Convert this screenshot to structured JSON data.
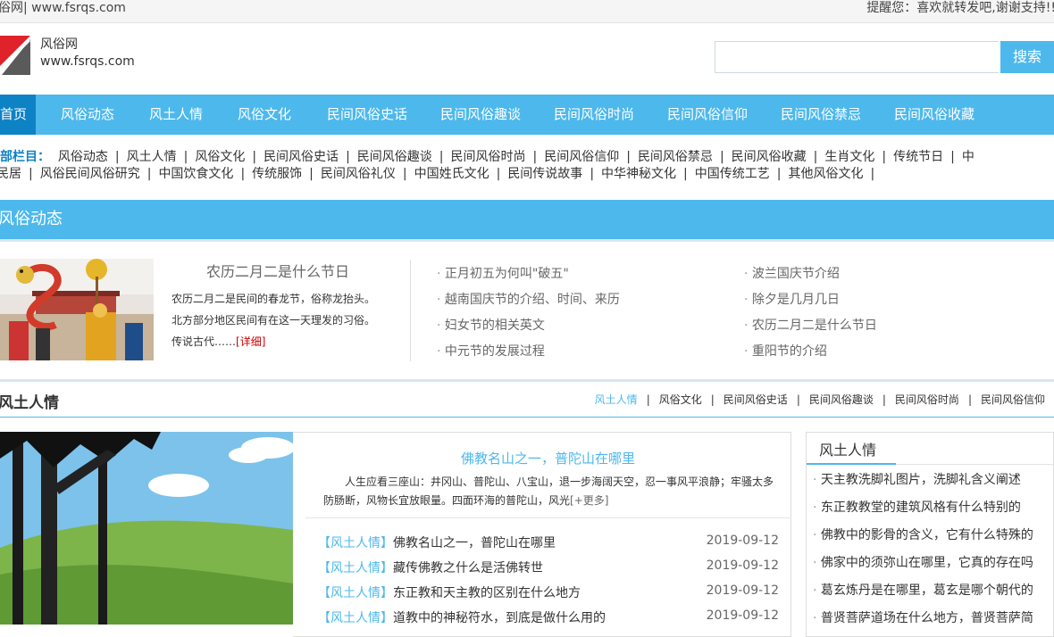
{
  "topbar": {
    "left_text": "风俗网| www.fsrqs.com",
    "right_text": "提醒您：喜欢就转发吧,谢谢支持!!"
  },
  "header": {
    "site_name": "风俗网",
    "site_url": "www.fsrqs.com",
    "search_placeholder": "",
    "search_button": "搜索"
  },
  "nav": {
    "items": [
      "首页",
      "风俗动态",
      "风土人情",
      "风俗文化",
      "民间风俗史话",
      "民间风俗趣谈",
      "民间风俗时尚",
      "民间风俗信仰",
      "民间风俗禁忌",
      "民间风俗收藏"
    ]
  },
  "all_columns": {
    "label": "全部栏目：",
    "row1": [
      "风俗动态",
      "风土人情",
      "风俗文化",
      "民间风俗史话",
      "民间风俗趣谈",
      "民间风俗时尚",
      "民间风俗信仰",
      "民间风俗禁忌",
      "民间风俗收藏",
      "生肖文化",
      "传统节日",
      "中"
    ],
    "row2": [
      "民居",
      "风俗民间风俗研究",
      "中国饮食文化",
      "传统服饰",
      "民间风俗礼仪",
      "中国姓氏文化",
      "民间传说故事",
      "中华神秘文化",
      "中国传统工艺",
      "其他风俗文化"
    ]
  },
  "section1": {
    "title": "风俗动态",
    "feature_title": "农历二月二是什么节日",
    "feature_text": "农历二月二是民间的春龙节，俗称龙抬头。北方部分地区民间有在这一天理发的习俗。传说古代……",
    "feature_more": "[详细]",
    "links_left": [
      "正月初五为何叫\"破五\"",
      "越南国庆节的介绍、时间、来历",
      "妇女节的相关英文",
      "中元节的发展过程"
    ],
    "links_right": [
      "波兰国庆节介绍",
      "除夕是几月几日",
      "农历二月二是什么节日",
      "重阳节的介绍"
    ]
  },
  "section2": {
    "title": "风土人情",
    "tabs": [
      "风土人情",
      "风俗文化",
      "民间风俗史话",
      "民间风俗趣谈",
      "民间风俗时尚",
      "民间风俗信仰"
    ],
    "feature_title": "佛教名山之一，普陀山在哪里",
    "feature_text": "人生应看三座山：井冈山、普陀山、八宝山，退一步海阔天空，忍一事风平浪静；牢骚太多防肠断，风物长宜放眼量。四面环海的普陀山，风光",
    "feature_more": "[+更多]",
    "list": [
      {
        "cat": "【风土人情】",
        "title": "佛教名山之一，普陀山在哪里",
        "date": "2019-09-12"
      },
      {
        "cat": "【风土人情】",
        "title": "藏传佛教之什么是活佛转世",
        "date": "2019-09-12"
      },
      {
        "cat": "【风土人情】",
        "title": "东正教和天主教的区别在什么地方",
        "date": "2019-09-12"
      },
      {
        "cat": "【风土人情】",
        "title": "道教中的神秘符水，到底是做什么用的",
        "date": "2019-09-12"
      }
    ],
    "sidebar_title": "风土人情",
    "sidebar_items": [
      "天主教洗脚礼图片，洗脚礼含义阐述",
      "东正教教堂的建筑风格有什么特别的",
      "佛教中的影骨的含义，它有什么特殊的",
      "佛家中的须弥山在哪里，它真的存在吗",
      "葛玄炼丹是在哪里，葛玄是哪个朝代的",
      "普贤菩萨道场在什么地方，普贤菩萨简"
    ]
  },
  "colors": {
    "accent": "#4db8ec",
    "nav_active": "#0d82c4",
    "more_red": "#cc0000"
  }
}
